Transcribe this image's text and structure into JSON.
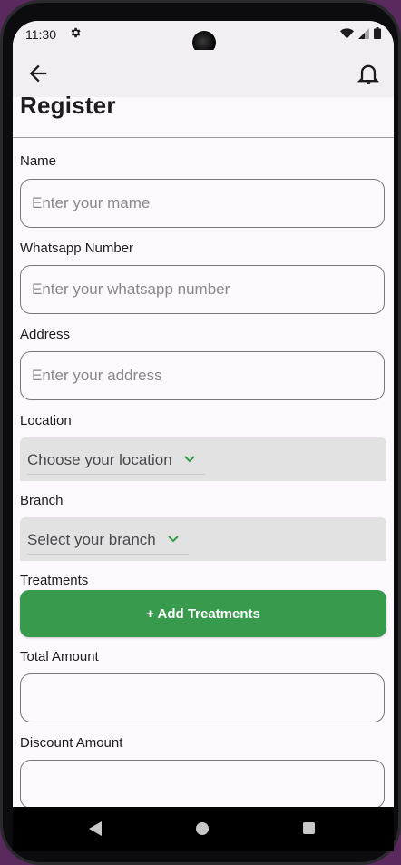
{
  "status_bar": {
    "time": "11:30"
  },
  "page": {
    "title": "Register"
  },
  "form": {
    "name": {
      "label": "Name",
      "placeholder": "Enter your mame"
    },
    "whatsapp": {
      "label": "Whatsapp Number",
      "placeholder": "Enter your whatsapp number"
    },
    "address": {
      "label": "Address",
      "placeholder": "Enter your address"
    },
    "location": {
      "label": "Location",
      "value": "Choose your location"
    },
    "branch": {
      "label": "Branch",
      "value": "Select your branch"
    },
    "treatments": {
      "label": "Treatments",
      "button_label": "+ Add Treatments"
    },
    "total_amount": {
      "label": "Total Amount",
      "placeholder": ""
    },
    "discount_amount": {
      "label": "Discount Amount",
      "placeholder": ""
    }
  },
  "colors": {
    "accent": "#389a4d",
    "background": "#fdf8fd",
    "appbar": "#f3eef3"
  },
  "icons": {
    "back": "arrow-left-icon",
    "bell": "bell-icon",
    "gear": "gear-icon",
    "wifi": "wifi-icon",
    "signal": "signal-icon",
    "battery": "battery-icon",
    "dropdown": "chevron-down-icon"
  }
}
